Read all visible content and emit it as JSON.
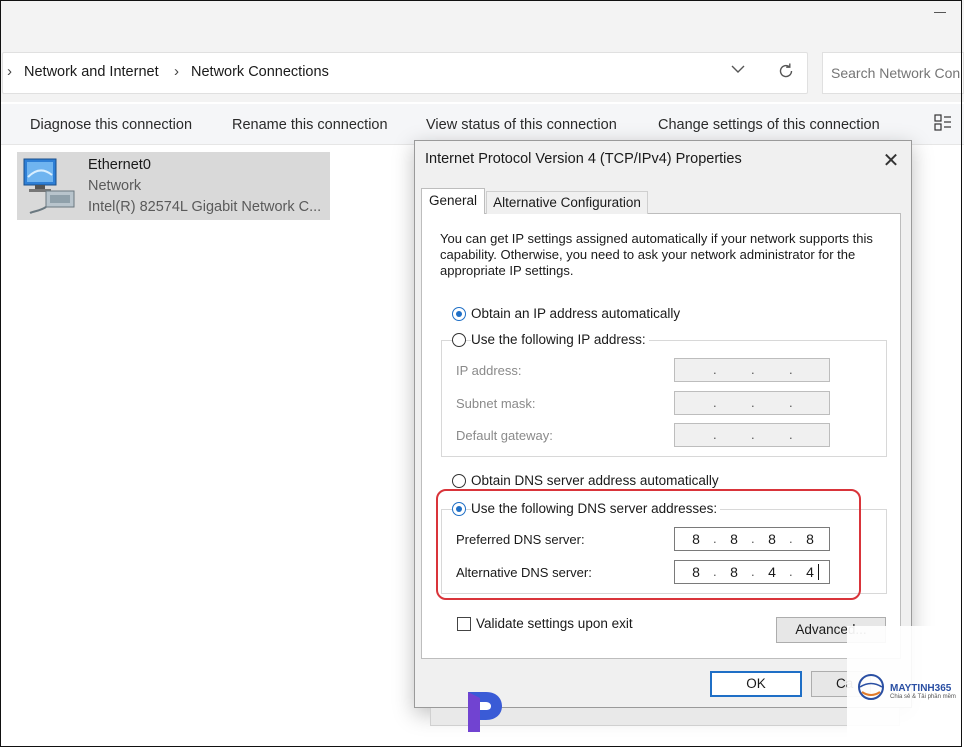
{
  "explorer": {
    "breadcrumb": [
      "Network and Internet",
      "Network Connections"
    ],
    "search_placeholder": "Search Network Con",
    "toolbar": {
      "diagnose": "Diagnose this connection",
      "rename": "Rename this connection",
      "view_status": "View status of this connection",
      "change_settings": "Change settings of this connection"
    },
    "item": {
      "name": "Ethernet0",
      "type": "Network",
      "adapter": "Intel(R) 82574L Gigabit Network C..."
    }
  },
  "dialog": {
    "title": "Internet Protocol Version 4 (TCP/IPv4) Properties",
    "tabs": [
      "General",
      "Alternative Configuration"
    ],
    "description": "You can get IP settings assigned automatically if your network supports this capability. Otherwise, you need to ask your network administrator for the appropriate IP settings.",
    "ip_auto_label": "Obtain an IP address automatically",
    "ip_manual_label": "Use the following IP address:",
    "ip_fields": [
      {
        "label": "IP address:"
      },
      {
        "label": "Subnet mask:"
      },
      {
        "label": "Default gateway:"
      }
    ],
    "dns_auto_label": "Obtain DNS server address automatically",
    "dns_manual_label": "Use the following DNS server addresses:",
    "dns_fields": [
      {
        "label": "Preferred DNS server:",
        "octets": [
          "8",
          "8",
          "8",
          "8"
        ]
      },
      {
        "label": "Alternative DNS server:",
        "octets": [
          "8",
          "8",
          "4",
          "4"
        ]
      }
    ],
    "validate_label": "Validate settings upon exit",
    "advanced_label": "Advanced...",
    "ok_label": "OK",
    "cancel_label": "Ca"
  },
  "watermark": {
    "brand": "MAYTINH365",
    "tagline": "Chia sẻ & Tải phần mềm"
  },
  "colors": {
    "accent": "#1f6fc6",
    "highlight": "#d9343a",
    "selection": "#d9d9d9"
  }
}
